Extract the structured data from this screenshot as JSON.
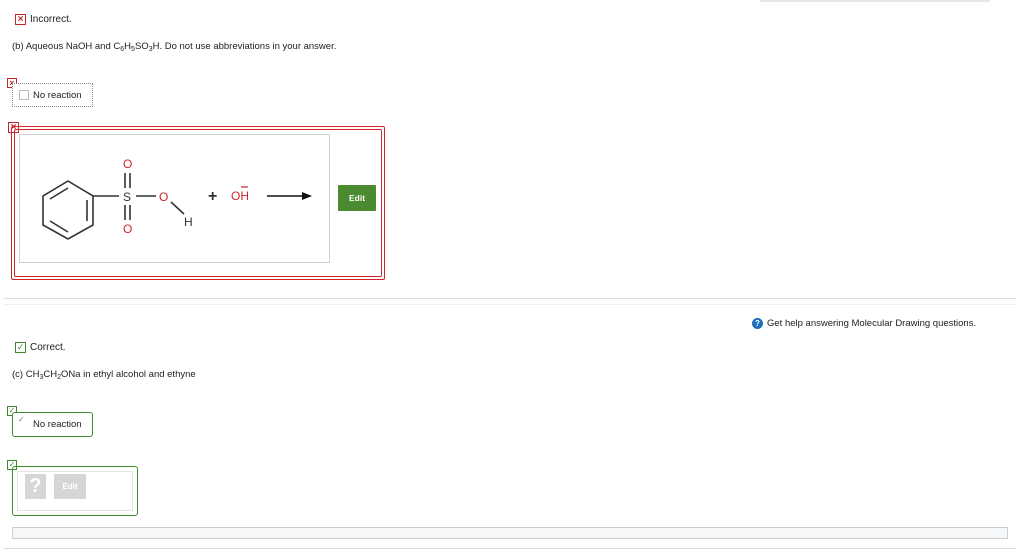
{
  "partB": {
    "status": "Incorrect.",
    "question_prefix": "(b) Aqueous NaOH and C",
    "sub1": "6",
    "mid1": "H",
    "sub2": "5",
    "mid2": "SO",
    "sub3": "3",
    "question_suffix": "H. Do not use abbreviations in your answer.",
    "no_reaction_label": "No reaction",
    "edit_label": "Edit",
    "molecule": {
      "atom_O_top": "O",
      "atom_S": "S",
      "atom_O_right": "O",
      "atom_O_bottom": "O",
      "atom_H": "H",
      "plus": "+",
      "hydroxide": "OH"
    }
  },
  "help": {
    "text": "Get help answering Molecular Drawing questions.",
    "icon": "help-circle-icon"
  },
  "partC": {
    "status": "Correct.",
    "question_prefix": "(c) CH",
    "sub1": "3",
    "mid1": "CH",
    "sub2": "2",
    "question_suffix": "ONa in ethyl alcohol and ethyne",
    "no_reaction_label": "No reaction",
    "placeholder_symbol": "?",
    "edit_label": "Edit"
  },
  "colors": {
    "incorrect": "#d2232a",
    "correct": "#3e8a2e",
    "edit_button": "#4c8a2f",
    "help_icon": "#1c6fb8"
  }
}
